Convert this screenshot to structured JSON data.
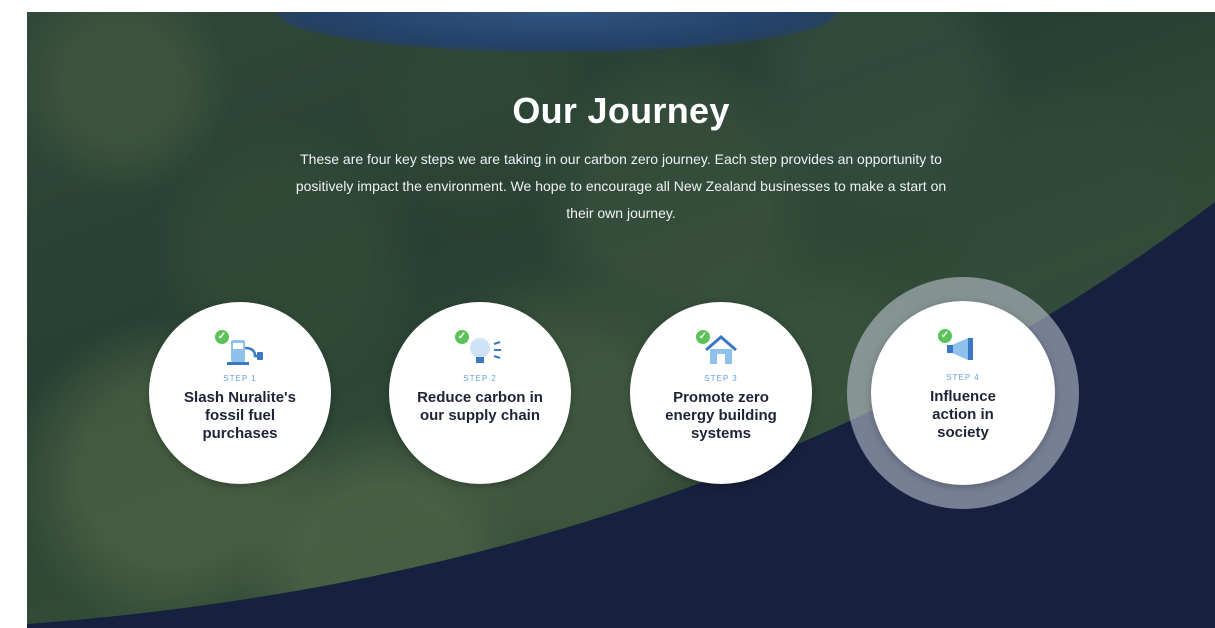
{
  "section": {
    "title": "Our Journey",
    "intro": "These are four key steps we are taking in our carbon zero journey. Each step provides an opportunity to positively impact the environment. We hope to encourage all New Zealand businesses to make a start on their own journey."
  },
  "steps": [
    {
      "label": "STEP 1",
      "name": "Slash Nuralite's fossil fuel purchases",
      "icon": "fuel-pump-plug-icon"
    },
    {
      "label": "STEP 2",
      "name": "Reduce carbon in our supply chain",
      "icon": "lightbulb-icon"
    },
    {
      "label": "STEP 3",
      "name": "Promote zero energy building systems",
      "icon": "house-icon"
    },
    {
      "label": "STEP 4",
      "name": "Influence action in society",
      "icon": "megaphone-icon"
    }
  ],
  "colors": {
    "navy": "#16213f",
    "check_green": "#5cc25a",
    "icon_blue": "#6a9fd4",
    "text_dark": "#1e2437"
  }
}
